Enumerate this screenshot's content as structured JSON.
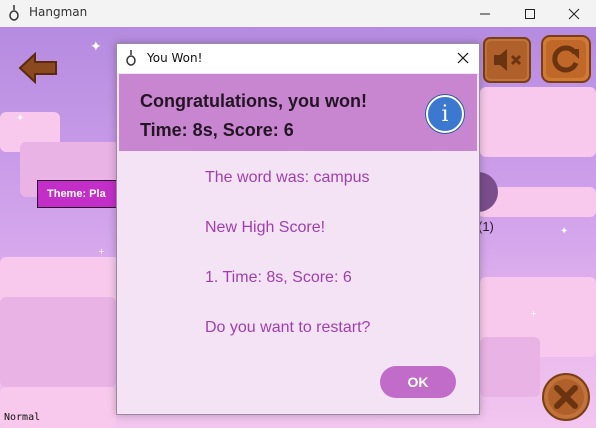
{
  "window": {
    "title": "Hangman",
    "icon": "noose-icon"
  },
  "game": {
    "theme_label": "Theme: Pla",
    "hint_count": "(1)",
    "difficulty": "Normal"
  },
  "dialog": {
    "title": "You Won!",
    "heading_line1": "Congratulations, you won!",
    "heading_line2": "Time: 8s, Score: 6",
    "lines": [
      "The word was: campus",
      "New High Score!",
      "1. Time: 8s, Score: 6",
      "Do you want to restart?"
    ],
    "ok_label": "OK"
  },
  "colors": {
    "header": "#c886d0",
    "accent_text": "#a040b0",
    "ok_button": "#c06cc8",
    "info_icon": "#3a79cf"
  }
}
